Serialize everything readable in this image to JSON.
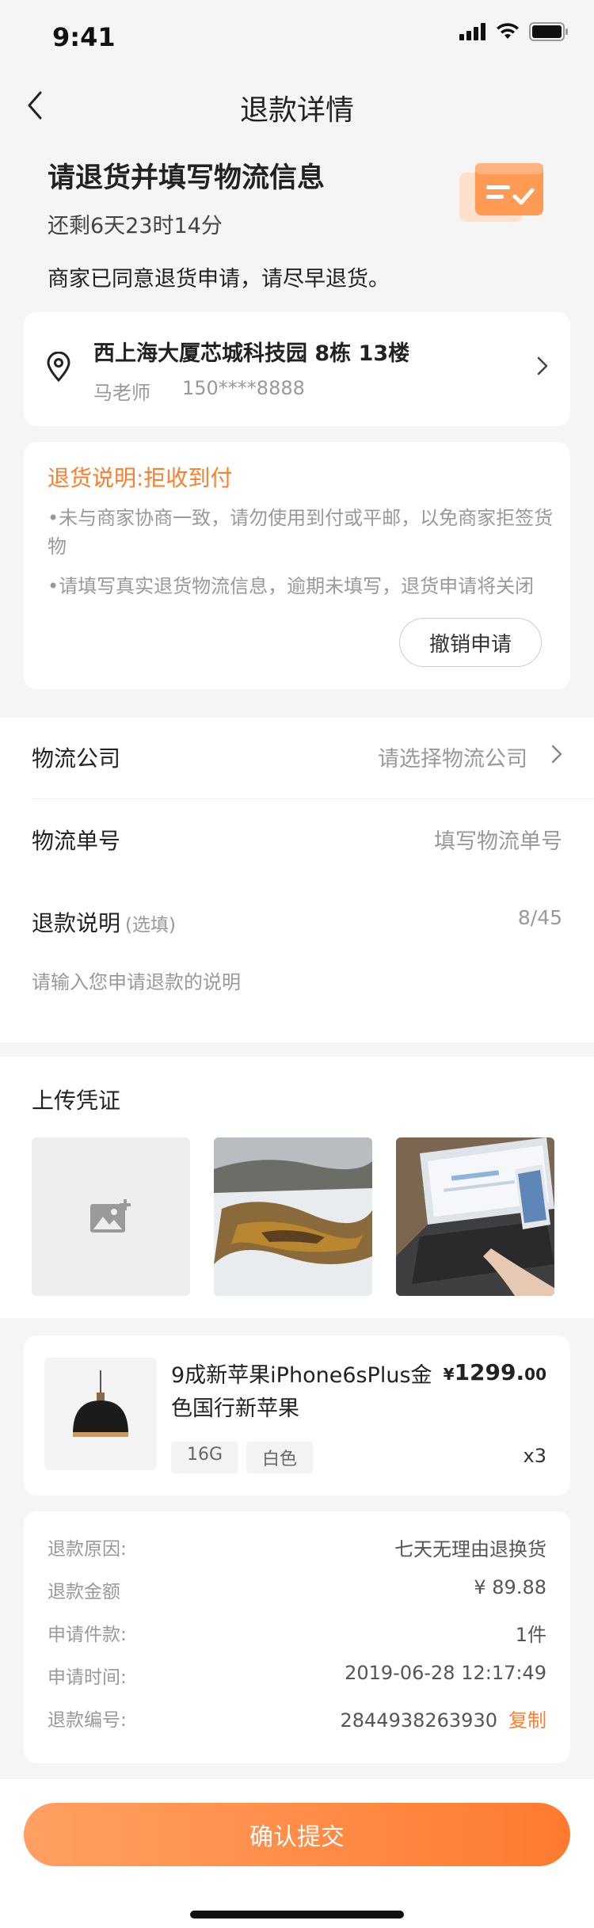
{
  "status_bar": {
    "time": "9:41"
  },
  "nav": {
    "title": "退款详情"
  },
  "hero": {
    "title": "请退货并填写物流信息",
    "countdown": "还剩6天23时14分",
    "merchant_note": "商家已同意退货申请，请尽早退货。"
  },
  "address": {
    "line": "西上海大厦芯城科技园 8栋 13楼",
    "name": "马老师",
    "phone": "150****8888"
  },
  "notice": {
    "title": "退货说明:拒收到付",
    "bullets": [
      "•未与商家协商一致，请勿使用到付或平邮，以免商家拒签货物",
      "•请填写真实退货物流信息，逾期未填写，退货申请将关闭"
    ],
    "cancel_label": "撤销申请"
  },
  "form": {
    "logistics_company_label": "物流公司",
    "logistics_company_placeholder": "请选择物流公司",
    "tracking_label": "物流单号",
    "tracking_placeholder": "填写物流单号",
    "desc_label": "退款说明",
    "desc_optional": "(选填)",
    "desc_count": "8/45",
    "desc_placeholder": "请输入您申请退款的说明"
  },
  "upload": {
    "title": "上传凭证"
  },
  "product": {
    "title": "9成新苹果iPhone6sPlus金色国行新苹果",
    "price_currency": "¥",
    "price_main": "1299.",
    "price_decimal": "00",
    "tags": [
      "16G",
      "白色"
    ],
    "qty": "x3"
  },
  "info": {
    "rows": [
      {
        "label": "退款原因:",
        "value": "七天无理由退换货"
      },
      {
        "label": "退款金额",
        "value": "¥ 89.88"
      },
      {
        "label": "申请件款:",
        "value": "1件"
      },
      {
        "label": "申请时间:",
        "value": "2019-06-28 12:17:49"
      },
      {
        "label": "退款编号:",
        "value": "2844938263930"
      }
    ],
    "copy_label": "复制"
  },
  "footer": {
    "submit_label": "确认提交"
  },
  "colors": {
    "accent": "#ff7e2e",
    "background": "#f5f5f5"
  }
}
